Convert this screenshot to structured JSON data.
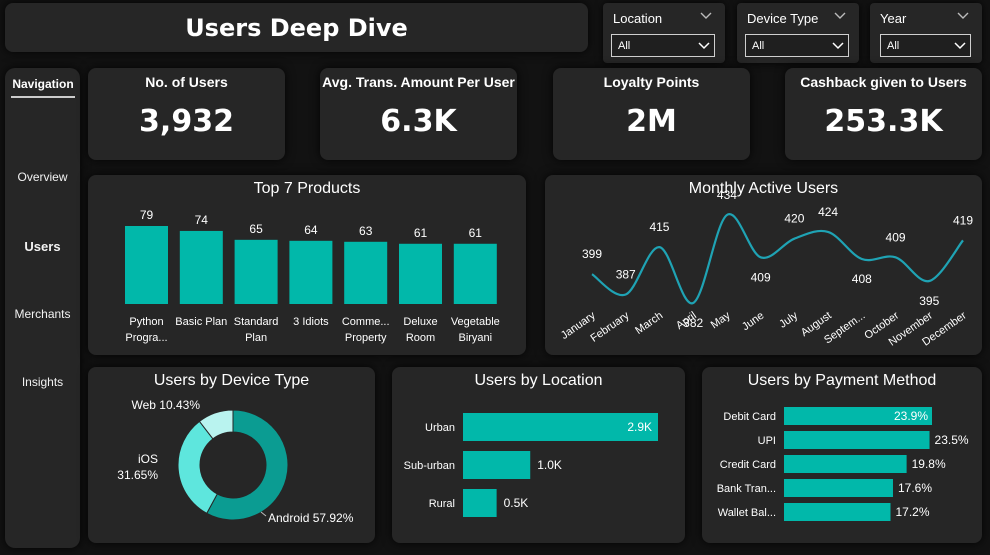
{
  "title": "Users Deep Dive",
  "filters": [
    {
      "label": "Location",
      "value": "All"
    },
    {
      "label": "Device Type",
      "value": "All"
    },
    {
      "label": "Year",
      "value": "All"
    }
  ],
  "navigation": {
    "heading": "Navigation",
    "items": [
      "Overview",
      "Users",
      "Merchants",
      "Insights"
    ],
    "active": "Users"
  },
  "kpis": [
    {
      "label": "No. of Users",
      "value": "3,932"
    },
    {
      "label": "Avg. Trans. Amount Per User",
      "value": "6.3K"
    },
    {
      "label": "Loyalty Points",
      "value": "2M"
    },
    {
      "label": "Cashback given to Users",
      "value": "253.3K"
    }
  ],
  "colors": {
    "teal": "#01B8AA",
    "teal_light": "#5EE6DD",
    "teal_pale": "#B9F3EF",
    "teal_dark": "#0B9C92",
    "line": "#1FA3B4"
  },
  "chart_data": [
    {
      "type": "bar",
      "title": "Top 7 Products",
      "categories": [
        "Python Progra...",
        "Basic Plan",
        "Standard Plan",
        "3 Idiots",
        "Comme... Property",
        "Deluxe Room",
        "Vegetable Biryani"
      ],
      "category_lines": [
        [
          "Python",
          "Progra..."
        ],
        [
          "Basic Plan"
        ],
        [
          "Standard",
          "Plan"
        ],
        [
          "3 Idiots"
        ],
        [
          "Comme...",
          "Property"
        ],
        [
          "Deluxe",
          "Room"
        ],
        [
          "Vegetable",
          "Biryani"
        ]
      ],
      "values": [
        79,
        74,
        65,
        64,
        63,
        61,
        61
      ],
      "ylim": [
        0,
        85
      ]
    },
    {
      "type": "line",
      "title": "Monthly Active Users",
      "categories": [
        "January",
        "February",
        "March",
        "April",
        "May",
        "June",
        "July",
        "August",
        "Septem...",
        "October",
        "November",
        "December"
      ],
      "values": [
        399,
        387,
        415,
        382,
        434,
        409,
        420,
        424,
        408,
        409,
        395,
        419
      ],
      "ylim": [
        375,
        440
      ]
    },
    {
      "type": "pie",
      "title": "Users by Device Type",
      "slices": [
        {
          "label": "Android",
          "value": 57.92,
          "text": "Android 57.92%"
        },
        {
          "label": "iOS",
          "value": 31.65,
          "text_lines": [
            "iOS",
            "31.65%"
          ]
        },
        {
          "label": "Web",
          "value": 10.43,
          "text": "Web 10.43%"
        }
      ]
    },
    {
      "type": "bar",
      "orientation": "horizontal",
      "title": "Users by Location",
      "categories": [
        "Urban",
        "Sub-urban",
        "Rural"
      ],
      "values": [
        2.9,
        1.0,
        0.5
      ],
      "labels": [
        "2.9K",
        "1.0K",
        "0.5K"
      ]
    },
    {
      "type": "bar",
      "orientation": "horizontal",
      "title": "Users by Payment Method",
      "categories": [
        "Debit Card",
        "UPI",
        "Credit Card",
        "Bank Tran...",
        "Wallet Bal..."
      ],
      "values": [
        23.9,
        23.5,
        19.8,
        17.6,
        17.2
      ],
      "labels": [
        "23.9%",
        "23.5%",
        "19.8%",
        "17.6%",
        "17.2%"
      ]
    }
  ]
}
